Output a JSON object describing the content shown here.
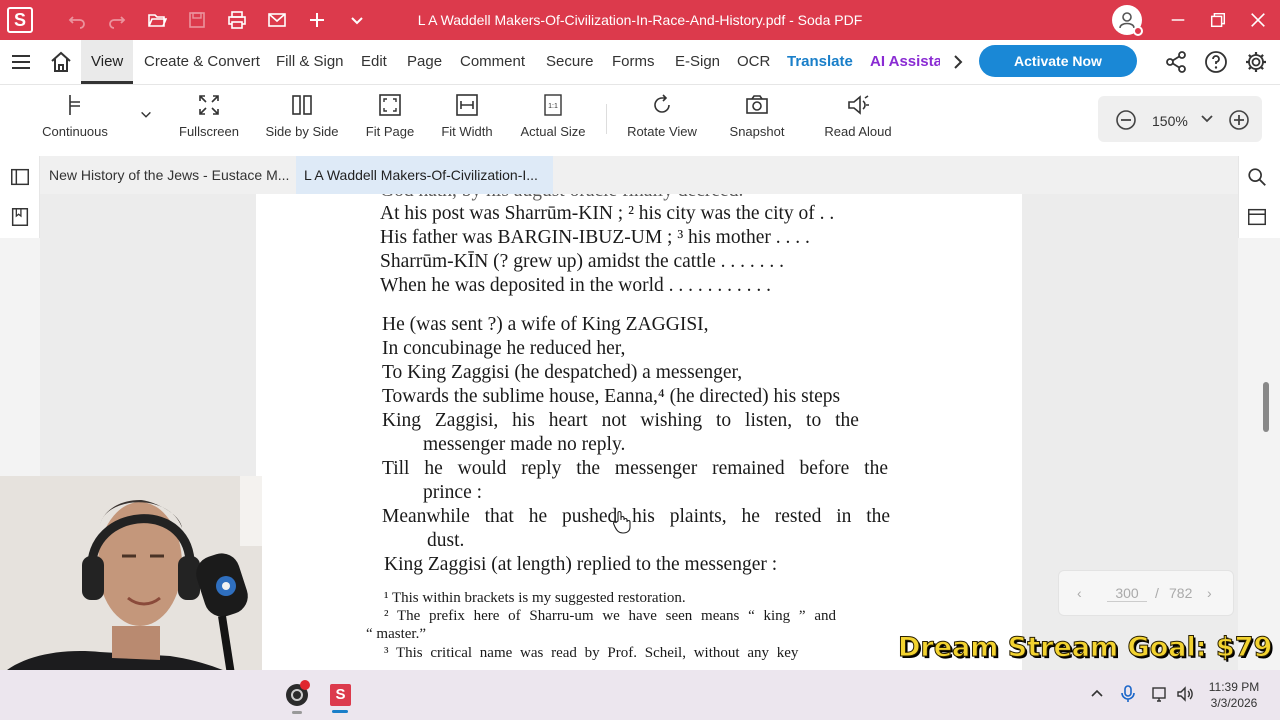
{
  "app": {
    "logo_letter": "S",
    "window_title": "L A Waddell Makers-Of-Civilization-In-Race-And-History.pdf   -   Soda PDF"
  },
  "menu": {
    "items": [
      "View",
      "Create & Convert",
      "Fill & Sign",
      "Edit",
      "Page",
      "Comment",
      "Secure",
      "Forms",
      "E-Sign",
      "OCR"
    ],
    "translate": "Translate",
    "ai": "AI Assista",
    "activate": "Activate Now",
    "colors": {
      "brand": "#dc3a4c",
      "activate": "#1a88d6",
      "translate": "#1a7fc9",
      "ai": "#8a2bd3"
    }
  },
  "toolbar": {
    "continuous": "Continuous",
    "fullscreen": "Fullscreen",
    "side_by_side": "Side by Side",
    "fit_page": "Fit Page",
    "fit_width": "Fit Width",
    "actual_size": "Actual Size",
    "rotate_view": "Rotate View",
    "snapshot": "Snapshot",
    "read_aloud": "Read Aloud",
    "zoom": "150%"
  },
  "tabs": [
    {
      "label": "New History of the Jews - Eustace M..."
    },
    {
      "label": "L A Waddell Makers-Of-Civilization-I..."
    }
  ],
  "document": {
    "lines": [
      "At his post was Sharrūm-KIN ; ² his city was the city of . .",
      "His father was BARGIN-IBUZ-UM ; ³ his mother . . . .",
      "Sharrūm-KĪN (? grew up) amidst the cattle . . . . . . .",
      "When he was deposited in the world . . . . . . . . . . .",
      "He (was sent ?) a wife of King ZAGGISI,",
      "In concubinage he reduced her,",
      "To King Zaggisi (he despatched) a messenger,",
      "Towards the sublime house, Eanna,⁴ (he directed) his steps",
      "King Zaggisi, his heart not wishing to listen, to the",
      "messenger made no reply.",
      "Till he would reply the messenger remained before the",
      "prince :",
      "Meanwhile that he pushed his plaints, he rested in the",
      "dust.",
      "King Zaggisi (at length) replied to the messenger :"
    ],
    "footnotes": [
      "¹ This within brackets is my suggested restoration.",
      "² The prefix here of Sharru-um we have seen means “ king ” and",
      "“ master.”",
      "³ This critical name was read by Prof. Scheil, without any key"
    ]
  },
  "pager": {
    "current": "300",
    "separator": "/",
    "total": "782"
  },
  "stream": {
    "goal": "Dream Stream Goal: $79"
  },
  "taskbar": {
    "time": "11:39 PM",
    "date": "3/3/2026"
  }
}
